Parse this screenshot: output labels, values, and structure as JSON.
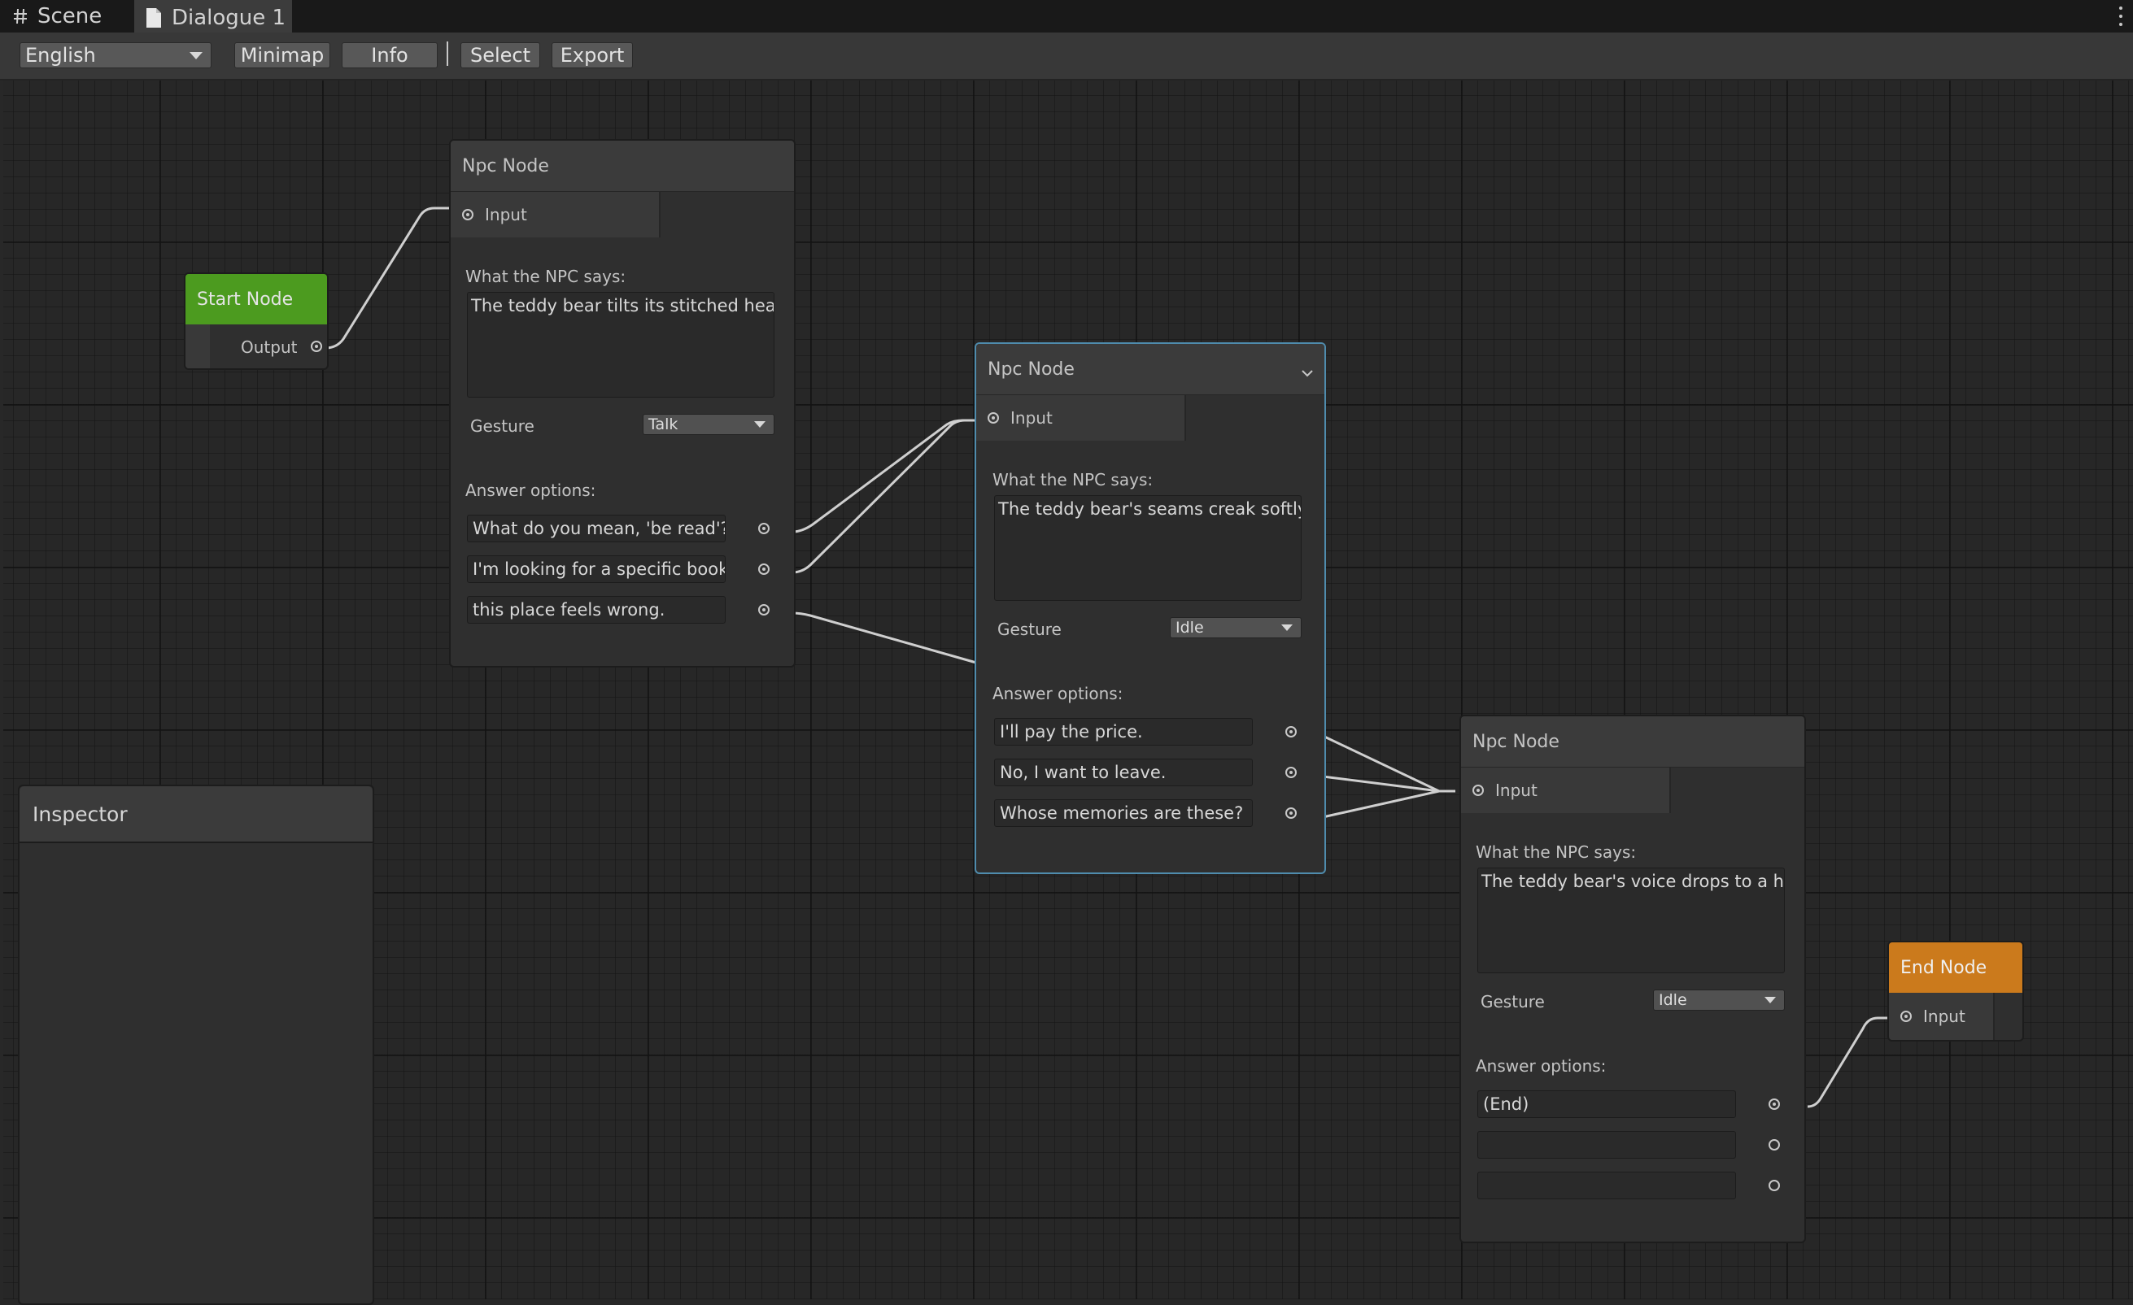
{
  "tabs": [
    {
      "label": "Scene",
      "icon": "grid-icon"
    },
    {
      "label": "Dialogue 1",
      "icon": "document-icon"
    }
  ],
  "toolbar": {
    "language": "English",
    "minimap": "Minimap",
    "info": "Info",
    "select": "Select",
    "export": "Export"
  },
  "inspector": {
    "title": "Inspector"
  },
  "start_node": {
    "title": "Start Node",
    "output_label": "Output"
  },
  "end_node": {
    "title": "End Node",
    "input_label": "Input"
  },
  "npc_nodes": [
    {
      "title": "Npc Node",
      "input_label": "Input",
      "says_label": "What the NPC says:",
      "says_text": "The teddy bear tilts its stitched head,",
      "gesture_label": "Gesture",
      "gesture": "Talk",
      "answers_label": "Answer options:",
      "answers": [
        "What do you mean, 'be read'?",
        "I'm looking for a specific book.",
        "this place feels wrong."
      ]
    },
    {
      "title": "Npc Node",
      "input_label": "Input",
      "says_label": "What the NPC says:",
      "says_text": "The teddy bear's seams creak softly a",
      "gesture_label": "Gesture",
      "gesture": "Idle",
      "answers_label": "Answer options:",
      "answers": [
        "I'll pay the price.",
        "No, I want to leave.",
        "Whose memories are these?"
      ]
    },
    {
      "title": "Npc Node",
      "input_label": "Input",
      "says_label": "What the NPC says:",
      "says_text": "The teddy bear's voice drops to a hollo",
      "gesture_label": "Gesture",
      "gesture": "Idle",
      "answers_label": "Answer options:",
      "answers": [
        "(End)",
        "",
        ""
      ]
    }
  ]
}
